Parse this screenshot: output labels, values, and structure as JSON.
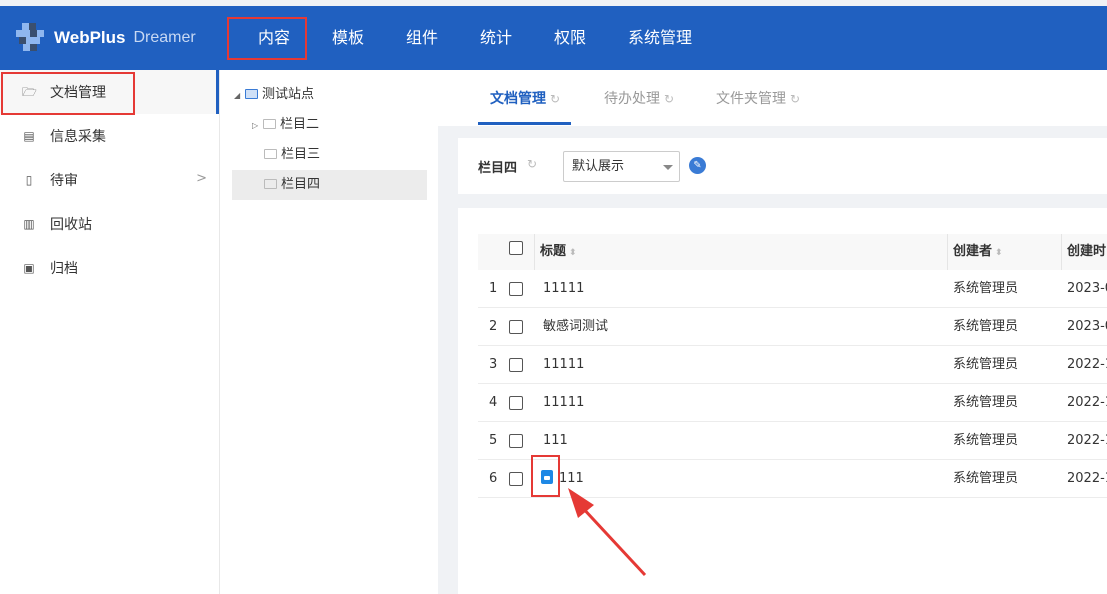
{
  "header": {
    "logo_text": "WebPlus",
    "logo_sub": "Dreamer",
    "nav": [
      {
        "label": "内容",
        "active": true
      },
      {
        "label": "模板"
      },
      {
        "label": "组件"
      },
      {
        "label": "统计"
      },
      {
        "label": "权限"
      },
      {
        "label": "系统管理"
      }
    ],
    "bg_color": "#2060c0"
  },
  "sidebar": {
    "items": [
      {
        "label": "文档管理",
        "icon": "folder-icon",
        "active": true
      },
      {
        "label": "信息采集",
        "icon": "clipboard-icon"
      },
      {
        "label": "待审",
        "icon": "pending-doc-icon",
        "has_arrow": true
      },
      {
        "label": "回收站",
        "icon": "trash-icon"
      },
      {
        "label": "归档",
        "icon": "archive-icon"
      }
    ]
  },
  "tree": {
    "root": "测试站点",
    "children": [
      "栏目二",
      "栏目三",
      "栏目四"
    ],
    "selected": "栏目四"
  },
  "tabs": [
    {
      "label": "文档管理",
      "active": true
    },
    {
      "label": "待办处理"
    },
    {
      "label": "文件夹管理"
    }
  ],
  "filter": {
    "column_label": "栏目四",
    "view_select": "默认展示"
  },
  "table": {
    "headers": [
      "标题",
      "创建者",
      "创建时"
    ],
    "rows": [
      {
        "index": "1",
        "title": "11111",
        "creator": "系统管理员",
        "created": "2023-0",
        "locked": false
      },
      {
        "index": "2",
        "title": "敏感词测试",
        "creator": "系统管理员",
        "created": "2023-0",
        "locked": false
      },
      {
        "index": "3",
        "title": "11111",
        "creator": "系统管理员",
        "created": "2022-1",
        "locked": false
      },
      {
        "index": "4",
        "title": "11111",
        "creator": "系统管理员",
        "created": "2022-1",
        "locked": false
      },
      {
        "index": "5",
        "title": "111",
        "creator": "系统管理员",
        "created": "2022-1",
        "locked": false
      },
      {
        "index": "6",
        "title": "111",
        "creator": "系统管理员",
        "created": "2022-1",
        "locked": true
      }
    ]
  },
  "annotation_color": "#e53935"
}
